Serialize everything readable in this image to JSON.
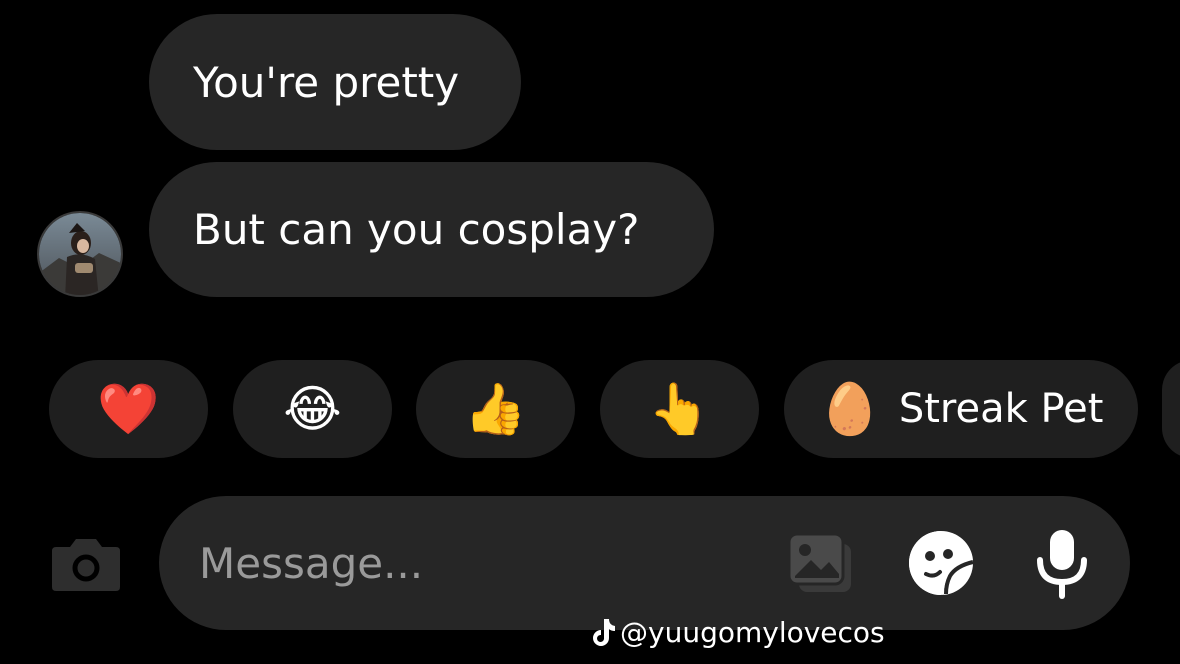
{
  "messages": [
    {
      "text": "You're pretty"
    },
    {
      "text": "But can you cosplay?"
    }
  ],
  "sender": {
    "avatar_icon": "user-avatar-photo"
  },
  "reactions": [
    {
      "emoji": "❤️",
      "icon": "red-heart-icon"
    },
    {
      "emoji": "😂",
      "icon": "tears-of-joy-icon"
    },
    {
      "emoji": "👍",
      "icon": "thumbs-up-icon"
    },
    {
      "emoji": "👆",
      "icon": "pointing-finger-icon"
    },
    {
      "emoji": "🥚",
      "icon": "egg-pet-icon",
      "label": "Streak Pet"
    }
  ],
  "composer": {
    "placeholder": "Message...",
    "icons": [
      "camera-icon",
      "gallery-icon",
      "sticker-icon",
      "microphone-icon"
    ]
  },
  "watermark": {
    "text": "@yuugomylovecos",
    "icon": "tiktok-icon"
  },
  "colors": {
    "background": "#000000",
    "bubble": "#262626",
    "chip": "#1f1f1f",
    "placeholder": "#9a9a9a"
  }
}
